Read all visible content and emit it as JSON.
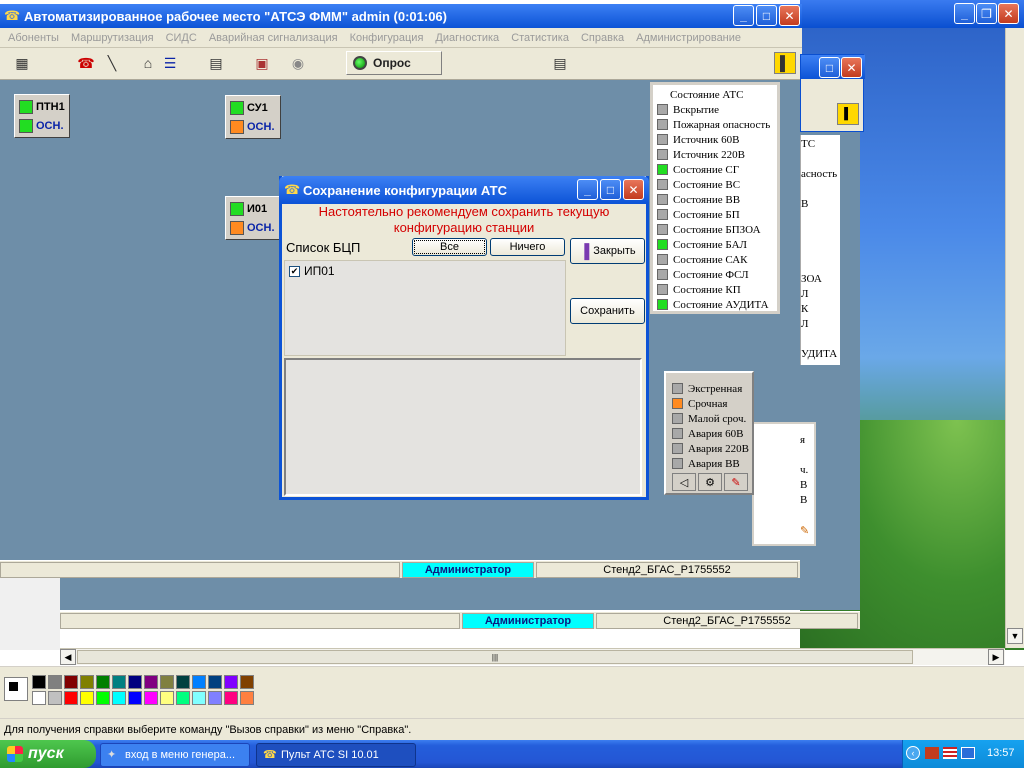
{
  "app": {
    "title": "Автоматизированное рабочее место \"АТСЭ ФММ\" admin (0:01:06)",
    "menu": [
      "Абоненты",
      "Маршрутизация",
      "СИДС",
      "Аварийная сигнализация",
      "Конфигурация",
      "Диагностика",
      "Статистика",
      "Справка",
      "Администрирование"
    ],
    "poll_label": "Опрос"
  },
  "nodes": [
    {
      "name": "ПТН1",
      "sub": "ОСН.",
      "color_top": "green",
      "color_bottom": "green"
    },
    {
      "name": "СУ1",
      "sub": "ОСН.",
      "color_top": "green",
      "color_bottom": "orange"
    },
    {
      "name": "И01",
      "sub": "ОСН.",
      "color_top": "green",
      "color_bottom": "orange"
    }
  ],
  "status_panel": {
    "items": [
      {
        "label": "Состояние АТС",
        "color": "none"
      },
      {
        "label": "Вскрытие",
        "color": "gray"
      },
      {
        "label": "Пожарная опасность",
        "color": "gray"
      },
      {
        "label": "Источник 60В",
        "color": "gray"
      },
      {
        "label": "Источник 220В",
        "color": "gray"
      },
      {
        "label": "Состояние СГ",
        "color": "green"
      },
      {
        "label": "Состояние ВС",
        "color": "gray"
      },
      {
        "label": "Состояние ВВ",
        "color": "gray"
      },
      {
        "label": "Состояние БП",
        "color": "gray"
      },
      {
        "label": "Состояние БПЗОА",
        "color": "gray"
      },
      {
        "label": "Состояние БАЛ",
        "color": "green"
      },
      {
        "label": "Состояние САК",
        "color": "gray"
      },
      {
        "label": "Состояние ФСЛ",
        "color": "gray"
      },
      {
        "label": "Состояние КП",
        "color": "gray"
      },
      {
        "label": "Состояние АУДИТА",
        "color": "green"
      }
    ]
  },
  "back_panel": {
    "fragments": [
      "ТС",
      "асность",
      "В",
      "ЗОА",
      "Л",
      "К",
      "Л",
      "УДИТА"
    ]
  },
  "alarm_panel": {
    "items": [
      {
        "label": "Экстренная",
        "color": "gray"
      },
      {
        "label": "Срочная",
        "color": "orange"
      },
      {
        "label": "Малой сроч.",
        "color": "gray"
      },
      {
        "label": "Авария 60В",
        "color": "gray"
      },
      {
        "label": "Авария 220В",
        "color": "gray"
      },
      {
        "label": "Авария ВВ",
        "color": "gray"
      }
    ],
    "back_fragments": [
      "я",
      "ч.",
      "В",
      "В"
    ]
  },
  "status_bars": [
    {
      "role": "Администратор",
      "station": "Стенд2_БГАС_Р1755552"
    },
    {
      "role": "Администратор",
      "station": "Стенд2_БГАС_Р1755552"
    }
  ],
  "dialog": {
    "title": "Сохранение конфигурации АТС",
    "warning_line1": "Настоятельно рекомендуем сохранить текущую",
    "warning_line2": "конфигурацию станции",
    "list_label": "Список БЦП",
    "all_button": "Все",
    "none_button": "Ничего",
    "close_button": "Закрыть",
    "save_button": "Сохранить",
    "list_items": [
      {
        "label": "ИП01",
        "checked": true
      }
    ]
  },
  "help_text": "Для получения справки выберите команду \"Вызов справки\" из меню \"Справка\".",
  "taskbar": {
    "start_label": "пуск",
    "tasks": [
      "вход в меню генера...",
      "Пульт АТС  SI 10.01"
    ],
    "clock": "13:57"
  },
  "colors": {
    "accent_blue": "#0c53d6",
    "status_cyan": "#00ffff",
    "warning_red": "#d40000",
    "green": "#22dd22",
    "orange": "#ff8a20"
  }
}
